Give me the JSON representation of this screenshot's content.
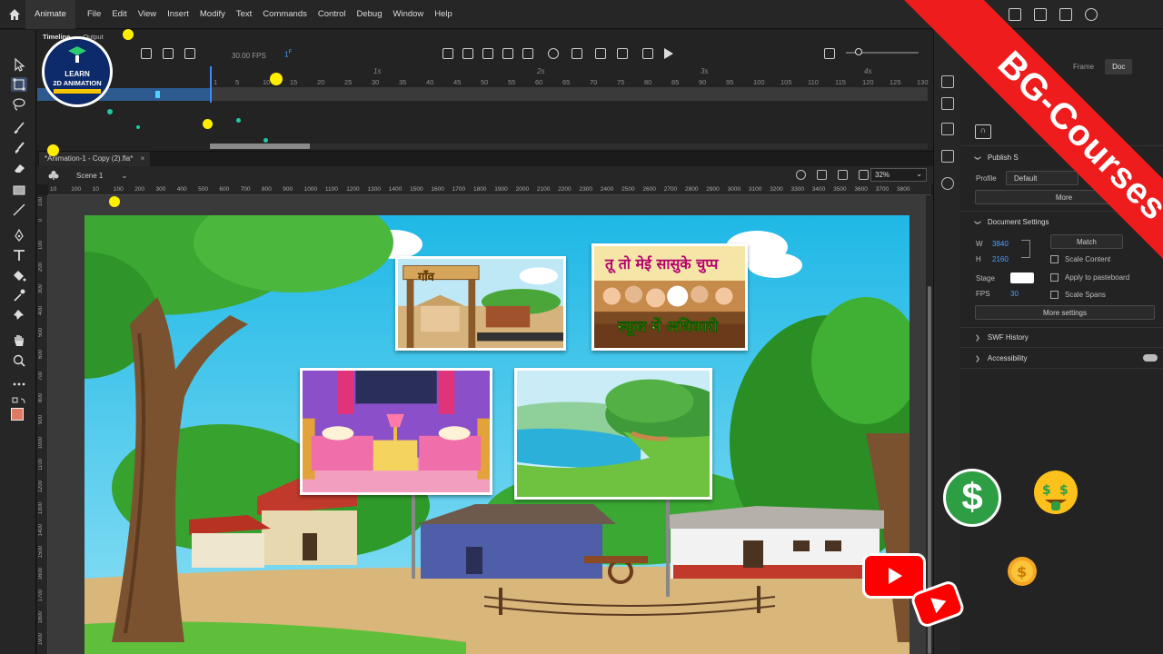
{
  "app": {
    "tab": "Animate",
    "menus": [
      "File",
      "Edit",
      "View",
      "Insert",
      "Modify",
      "Text",
      "Commands",
      "Control",
      "Debug",
      "Window",
      "Help"
    ]
  },
  "timeline": {
    "tabs": [
      "Timeline",
      "Output"
    ],
    "fps": "30.00",
    "fps_unit": "FPS",
    "current_frame": "1",
    "frame_unit": "F",
    "seconds": [
      "1s",
      "2s",
      "3s",
      "4s"
    ],
    "frame_numbers": [
      "1",
      "5",
      "10",
      "15",
      "20",
      "25",
      "30",
      "35",
      "40",
      "45",
      "50",
      "55",
      "60",
      "65",
      "70",
      "75",
      "80",
      "85",
      "90",
      "95",
      "100",
      "105",
      "110",
      "115",
      "120",
      "125",
      "130"
    ]
  },
  "document": {
    "tab_title": "*Animation-1 - Copy (2).fla*",
    "scene": "Scene 1",
    "zoom": "32%"
  },
  "rulers": {
    "horizontal": [
      "10",
      "100",
      "10",
      "100",
      "200",
      "300",
      "400",
      "500",
      "600",
      "700",
      "800",
      "900",
      "1000",
      "1100",
      "1200",
      "1300",
      "1400",
      "1500",
      "1600",
      "1700",
      "1800",
      "1900",
      "2000",
      "2100",
      "2200",
      "2300",
      "2400",
      "2500",
      "2600",
      "2700",
      "2800",
      "2900",
      "3000",
      "3100",
      "3200",
      "3300",
      "3400",
      "3500",
      "3600",
      "3700",
      "3800"
    ],
    "vertical": [
      "100",
      "0",
      "100",
      "200",
      "300",
      "400",
      "500",
      "600",
      "700",
      "800",
      "900",
      "1000",
      "1100",
      "1200",
      "1300",
      "1400",
      "1500",
      "1600",
      "1700",
      "1800",
      "1900"
    ]
  },
  "stage_content": {
    "gaon_sign": "गाँव",
    "school_title": "तू तो मेई सासुके चुप्प",
    "school_subtitle": "स्कूल में अधिकारी"
  },
  "properties": {
    "tabs": [
      "Frame",
      "Doc"
    ],
    "publish_settings": {
      "header": "Publish S",
      "profile_label": "Profile",
      "profile_value": "Default",
      "more_button": "More"
    },
    "document_settings": {
      "header": "Document Settings",
      "w_label": "W",
      "w_value": "3840",
      "h_label": "H",
      "h_value": "2160",
      "match_button": "Match",
      "stage_label": "Stage",
      "fps_label": "FPS",
      "fps_value": "30",
      "scale_content": "Scale Content",
      "apply_pasteboard": "Apply to pasteboard",
      "scale_spans": "Scale Spans",
      "more_settings": "More settings"
    },
    "swf_history": "SWF History",
    "accessibility": "Accessibility"
  },
  "overlay": {
    "ribbon_text": "BG-Courses",
    "logo_line1": "LEARN",
    "logo_line2": "2D ANIMATION",
    "dollar_symbol": "$"
  },
  "colors": {
    "ribbon": "#ee1c1c",
    "playhead": "#3b8bff",
    "accent_value": "#4aa3ff",
    "fill_color": "#e07b63",
    "sky": "#34c5e8"
  },
  "icons": [
    "home-icon",
    "arrow-icon",
    "free-transform-icon",
    "lasso-icon",
    "brush-icon",
    "eraser-icon",
    "rectangle-icon",
    "line-icon",
    "pen-icon",
    "text-icon",
    "paint-bucket-icon",
    "eyedropper-icon",
    "pin-icon",
    "hand-icon",
    "zoom-icon",
    "more-icon",
    "camera-icon",
    "play-icon",
    "loop-icon",
    "youtube-icon",
    "money-face-icon",
    "coin-icon"
  ]
}
